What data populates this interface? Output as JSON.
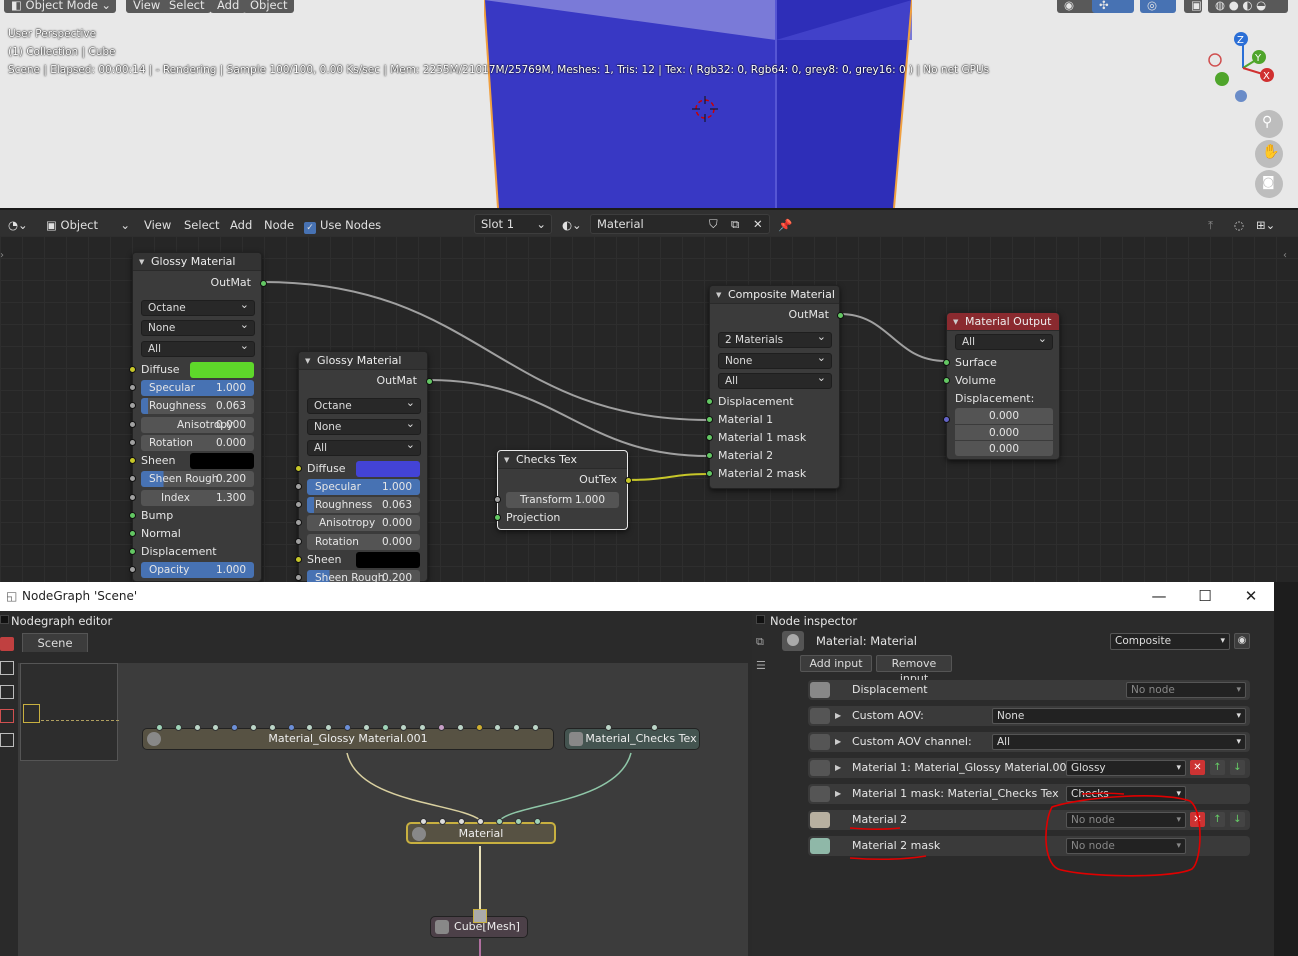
{
  "colors": {
    "accent": "#4772b3",
    "cube": "#3535c2",
    "diffuse1": "#5ed82a",
    "diffuse2": "#4343d6",
    "sheen": "#000000",
    "annotation": "#e00000"
  },
  "viewport": {
    "mode_label": "Object Mode",
    "menu": [
      "View",
      "Select",
      "Add",
      "Object"
    ],
    "info_line1": "User Perspective",
    "info_line2": "(1) Collection | Cube",
    "info_line3": "Scene | Elapsed: 00:00:14 | - Rendering | Sample 100/100, 0.00 Ks/sec | Mem: 2255M/21017M/25769M, Meshes: 1, Tris: 12 | Tex: ( Rgb32: 0, Rgb64: 0, grey8: 0, grey16: 0 ) | No net GPUs",
    "gizmo": {
      "z": "Z",
      "y": "Y",
      "x": "X"
    }
  },
  "node_header": {
    "object_label": "Object",
    "menu": [
      "View",
      "Select",
      "Add",
      "Node"
    ],
    "use_nodes_label": "Use Nodes",
    "slot_label": "Slot 1",
    "material_name": "Material"
  },
  "nodes": {
    "glossy1": {
      "title": "Glossy Material",
      "out": "OutMat",
      "sel1": "Octane",
      "sel2": "None",
      "sel3": "All",
      "diffuse": "Diffuse",
      "specular": {
        "label": "Specular",
        "value": "1.000"
      },
      "roughness": {
        "label": "Roughness",
        "value": "0.063"
      },
      "anisotropy": {
        "label": "Anisotropy",
        "value": "0.000"
      },
      "rotation": {
        "label": "Rotation",
        "value": "0.000"
      },
      "sheen": "Sheen",
      "sheen_rough": {
        "label": "Sheen Rough",
        "value": "0.200"
      },
      "index": {
        "label": "Index",
        "value": "1.300"
      },
      "bump": "Bump",
      "normal": "Normal",
      "displacement": "Displacement",
      "opacity": {
        "label": "Opacity",
        "value": "1.000"
      }
    },
    "glossy2": {
      "title": "Glossy Material",
      "out": "OutMat",
      "sel1": "Octane",
      "sel2": "None",
      "sel3": "All",
      "diffuse": "Diffuse",
      "specular": {
        "label": "Specular",
        "value": "1.000"
      },
      "roughness": {
        "label": "Roughness",
        "value": "0.063"
      },
      "anisotropy": {
        "label": "Anisotropy",
        "value": "0.000"
      },
      "rotation": {
        "label": "Rotation",
        "value": "0.000"
      },
      "sheen": "Sheen",
      "sheen_rough": {
        "label": "Sheen Rough",
        "value": "0.200"
      }
    },
    "checks": {
      "title": "Checks Tex",
      "out": "OutTex",
      "transform": {
        "label": "Transform",
        "value": "1.000"
      },
      "projection": "Projection"
    },
    "composite": {
      "title": "Composite Material",
      "out": "OutMat",
      "sel1": "2 Materials",
      "sel2": "None",
      "sel3": "All",
      "inputs": [
        "Displacement",
        "Material 1",
        "Material 1 mask",
        "Material 2",
        "Material 2 mask"
      ]
    },
    "output": {
      "title": "Material Output",
      "sel": "All",
      "surface": "Surface",
      "volume": "Volume",
      "displacement": "Displacement:",
      "values": [
        "0.000",
        "0.000",
        "0.000"
      ]
    }
  },
  "nodegraph": {
    "window_title": "NodeGraph 'Scene'",
    "editor_label": "Nodegraph editor",
    "tab": "Scene",
    "nodes": {
      "glossy": "Material_Glossy Material.001",
      "checks": "Material_Checks Tex",
      "material": "Material",
      "mesh": "Cube[Mesh]"
    }
  },
  "inspector": {
    "title": "Node inspector",
    "material_label": "Material: Material",
    "type": "Composite",
    "add_input": "Add input",
    "remove_input": "Remove input",
    "rows": [
      {
        "label": "Displacement",
        "value": "No node"
      },
      {
        "label": "Custom AOV:",
        "value": "None"
      },
      {
        "label": "Custom AOV channel:",
        "value": "All"
      },
      {
        "label": "Material 1: Material_Glossy Material.001",
        "value": "Glossy"
      },
      {
        "label": "Material 1 mask: Material_Checks Tex",
        "value": "Checks"
      },
      {
        "label": "Material 2",
        "value": "No node"
      },
      {
        "label": "Material 2 mask",
        "value": "No node"
      }
    ]
  }
}
